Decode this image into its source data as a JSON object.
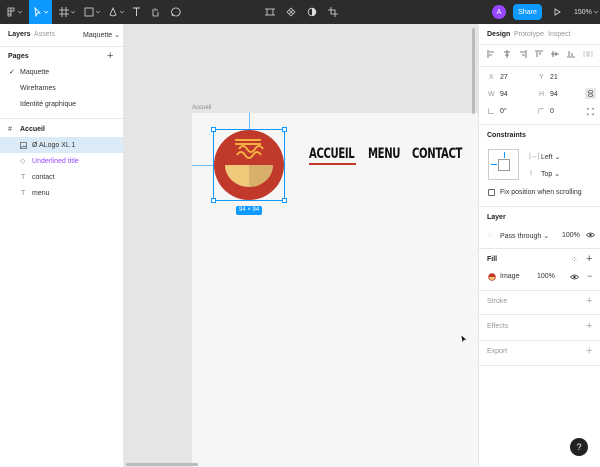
{
  "toolbar": {
    "share_label": "Share",
    "zoom_label": "150%",
    "avatar_initial": "A",
    "colors": {
      "bar": "#2c2c2c",
      "accent": "#0d99ff",
      "avatar": "#9747ff"
    }
  },
  "left_panel": {
    "tabs": [
      "Layers",
      "Assets"
    ],
    "page_selector": "Maquette",
    "pages_heading": "Pages",
    "pages": [
      {
        "label": "Maquette",
        "current": true
      },
      {
        "label": "Wireframes",
        "current": false
      },
      {
        "label": "Identité graphique",
        "current": false
      }
    ],
    "frame_name": "Accueil",
    "layers": [
      {
        "label": "Ø ALogo XL 1",
        "icon": "image-layer-icon",
        "selected": true
      },
      {
        "label": "Underlined title",
        "icon": "component-icon",
        "selected": false
      },
      {
        "label": "contact",
        "icon": "text-layer-icon",
        "selected": false
      },
      {
        "label": "menu",
        "icon": "text-layer-icon",
        "selected": false
      }
    ]
  },
  "canvas": {
    "frame_label": "Accueil",
    "nav": [
      "ACCUEIL",
      "MENU",
      "CONTACT"
    ],
    "size_badge": "94 × 94",
    "colors": {
      "logo_red": "#c0392b",
      "bowl": "#f0c97a",
      "noodles": "#f5b041"
    }
  },
  "right_panel": {
    "tabs": [
      "Design",
      "Prototype",
      "Inspect"
    ],
    "x_label": "X",
    "x": "27",
    "y_label": "Y",
    "y": "21",
    "w_label": "W",
    "w": "94",
    "h_label": "H",
    "h": "94",
    "rotation": "0°",
    "radius": "0",
    "constraints_heading": "Constraints",
    "constraint_h": "Left",
    "constraint_v": "Top",
    "fix_scroll_label": "Fix position when scrolling",
    "layer_heading": "Layer",
    "blend_mode": "Pass through",
    "layer_opacity": "100%",
    "fill_heading": "Fill",
    "fill_type": "Image",
    "fill_opacity": "100%",
    "stroke_heading": "Stroke",
    "effects_heading": "Effects",
    "export_heading": "Export"
  },
  "help_label": "?"
}
